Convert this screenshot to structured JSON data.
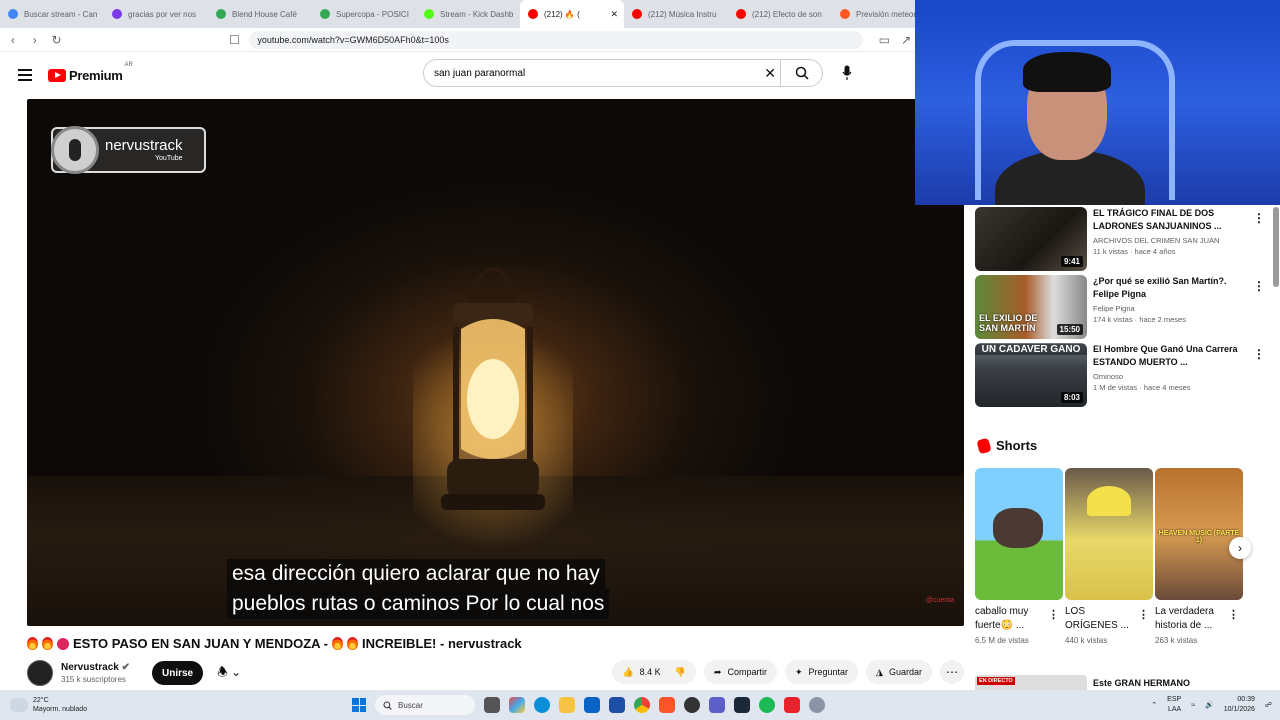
{
  "browser": {
    "tabs": [
      {
        "label": "Buscar stream - Can",
        "color": "#4285f4",
        "active": false
      },
      {
        "label": "gracias por ver nos",
        "color": "#7c3aed",
        "active": false
      },
      {
        "label": "Blend House Café",
        "color": "#34a853",
        "active": false
      },
      {
        "label": "Supercopa - POSICI",
        "color": "#34a853",
        "active": false
      },
      {
        "label": "Stream - Kick Dashb",
        "color": "#53fc18",
        "active": false
      },
      {
        "label": "(212) 🔥 (",
        "color": "#ff0000",
        "active": true
      },
      {
        "label": "(212) Música Instru",
        "color": "#ff0000",
        "active": false
      },
      {
        "label": "(212) Efecto de son",
        "color": "#ff0000",
        "active": false
      },
      {
        "label": "Previsión meteor",
        "color": "#ff5722",
        "active": false
      }
    ],
    "url": "youtube.com/watch?v=GWM6D50AFh0&t=100s"
  },
  "header": {
    "logo_text": "Premium",
    "logo_region": "AR",
    "search_value": "san juan paranormal"
  },
  "video": {
    "watermark_name": "nervustrack",
    "watermark_sub": "YouTube",
    "caption_line1": "esa dirección quiero aclarar que no hay",
    "caption_line2": "pueblos rutas o caminos Por lo cual nos",
    "title": "ESTO PASO EN SAN JUAN Y MENDOZA -",
    "title_part2": "INCREIBLE! - nervustrack",
    "corner_mark": "@cuenta"
  },
  "channel": {
    "name": "Nervustrack",
    "subs": "315 k suscriptores",
    "join_label": "Unirse"
  },
  "actions": {
    "likes": "8.4 K",
    "share": "Compartir",
    "ask": "Preguntar",
    "save": "Guardar"
  },
  "recommendations": [
    {
      "title": "EL TRÁGICO FINAL DE DOS LADRONES SANJUANINOS ...",
      "channel": "ARCHIVOS DEL CRIMEN SAN JUAN",
      "meta": "11 k vistas · hace 4 años",
      "duration": "9:41"
    },
    {
      "title": "¿Por qué se exilió San Martín?. Felipe Pigna",
      "channel": "Felipe Pigna",
      "meta": "174 k vistas · hace 2 meses",
      "duration": "15:50",
      "overlay": "EL EXILIO DE SAN MARTÍN"
    },
    {
      "title": "El Hombre Que Ganó Una Carrera ESTANDO MUERTO ...",
      "channel": "Ominoso",
      "meta": "1 M de vistas · hace 4 meses",
      "duration": "8:03",
      "overlay": "UN CADAVER GANO"
    }
  ],
  "shorts": {
    "heading": "Shorts",
    "items": [
      {
        "title": "caballo muy fuerte😳 ...",
        "views": "6.5 M de vistas"
      },
      {
        "title": "LOS ORÍGENES ...",
        "views": "440 k vistas"
      },
      {
        "title": "La verdadera historia de ...",
        "views": "263 k vistas",
        "overlay": "HEAVEN MUSIC (PARTE 1)"
      }
    ]
  },
  "live": {
    "badge": "EN DIRECTO",
    "title": "Este GRAN HERMANO"
  },
  "taskbar": {
    "temp": "22°C",
    "weather": "Mayorm. nublado",
    "search_label": "Buscar",
    "lang1": "ESP",
    "lang2": "LAA",
    "time": "00:39",
    "date": "10/1/2026"
  }
}
